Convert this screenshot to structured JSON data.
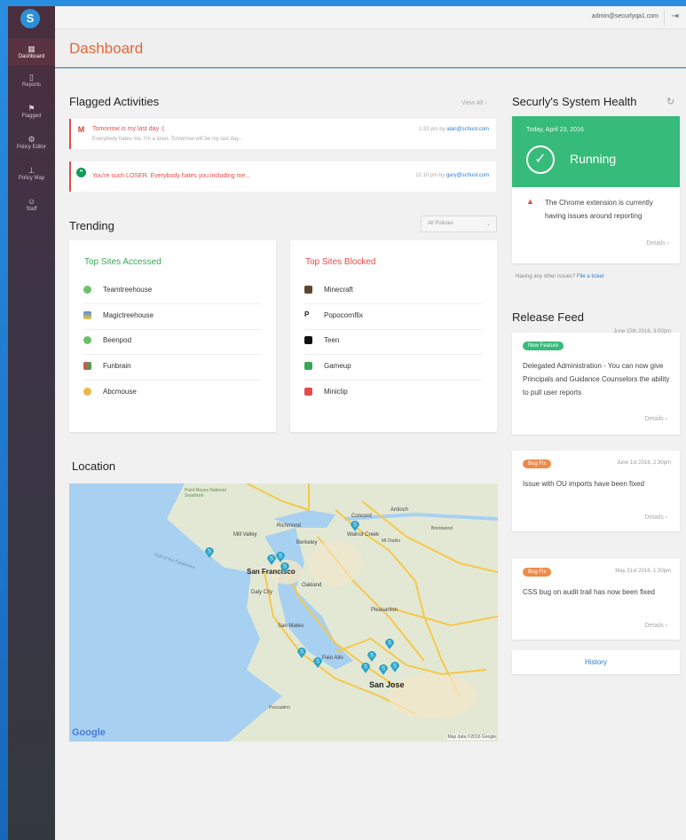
{
  "app": {
    "logo_letter": "S"
  },
  "topbar": {
    "email": "admin@securlyqa1.com",
    "logout_icon": "logout-icon"
  },
  "sidebar": {
    "items": [
      {
        "label": "Dashboard",
        "icon": "grid-icon",
        "active": true
      },
      {
        "label": "Reports",
        "icon": "document-icon"
      },
      {
        "label": "Flagged",
        "icon": "flag-icon"
      },
      {
        "label": "Policy Editor",
        "icon": "gear-icon"
      },
      {
        "label": "Policy Map",
        "icon": "hierarchy-icon"
      },
      {
        "label": "Staff",
        "icon": "people-icon"
      }
    ]
  },
  "page": {
    "title": "Dashboard"
  },
  "flagged": {
    "title": "Flagged Activities",
    "view_all": "View All",
    "items": [
      {
        "message": "Tomorrow is my last day :(",
        "sub": "Everybody hates me. I'm a loser. Tomorrow will be my last day...",
        "time": "1:33 pm by",
        "user": "alan@school.com",
        "icon": "gmail-icon"
      },
      {
        "message": "You're such LOSER. Everybody hates you including me...",
        "sub": "",
        "time": "12:10 pm by",
        "user": "gary@school.com",
        "icon": "hangouts-icon"
      }
    ]
  },
  "trending": {
    "title": "Trending",
    "filter": "All Policies",
    "accessed": {
      "title": "Top Sites Accessed",
      "color": "#3aa757",
      "sites": [
        "Teamtreehouse",
        "Magictreehouse",
        "Beenpod",
        "Funbrain",
        "Abcmouse"
      ]
    },
    "blocked": {
      "title": "Top Sites Blocked",
      "color": "#e34b4b",
      "sites": [
        "Minecraft",
        "Popocornflix",
        "Teen",
        "Gameup",
        "Miniclip"
      ]
    }
  },
  "location": {
    "title": "Location",
    "labels": {
      "google": "Google",
      "attribution": "Map data ©2016 Google",
      "sf": "San Francisco",
      "sj": "San Jose",
      "oakland": "Oakland",
      "richmond": "Richmond",
      "berkeley": "Berkeley",
      "concord": "Concord",
      "antioch": "Antioch",
      "walnut_creek": "Walnut Creek",
      "mill_valley": "Mill Valley",
      "daly_city": "Daly City",
      "san_mateo": "San Mateo",
      "palo_alto": "Palo Alto",
      "pleasanton": "Pleasanton",
      "pescadero": "Pescadero",
      "brentwood": "Brentwood",
      "mt_diablo": "Mt Diablo",
      "point_reyes": "Point Reyes National Seashore",
      "farallones": "Gulf of the Farallones"
    }
  },
  "health": {
    "title": "Securly's System Health",
    "date": "Today, April 23, 2016",
    "status": "Running",
    "status_color": "#37bb7a",
    "warning": "The Chrome extension is currently having issues around reporting",
    "details": "Details",
    "other_issues": "Having any other issues?",
    "ticket_link": "File a ticket"
  },
  "release": {
    "title": "Release Feed",
    "items": [
      {
        "badge": "New Feature",
        "badge_color": "#37bb7a",
        "date": "June 15th 2016, 3:00pm",
        "text": "Delegated Administration - You can now give Principals and Guidance Counselors the ability to pull user reports",
        "details": "Details"
      },
      {
        "badge": "Bug Fix",
        "badge_color": "#ee8a47",
        "date": "June 1st 2016, 2:30pm",
        "text": "Issue with OU imports have been fixed",
        "details": "Details"
      },
      {
        "badge": "Bug Fix",
        "badge_color": "#ee8a47",
        "date": "May 31st 2016, 1:30pm",
        "text": "CSS bug on audit trail has now been fixed",
        "details": "Details"
      }
    ],
    "history": "History"
  }
}
